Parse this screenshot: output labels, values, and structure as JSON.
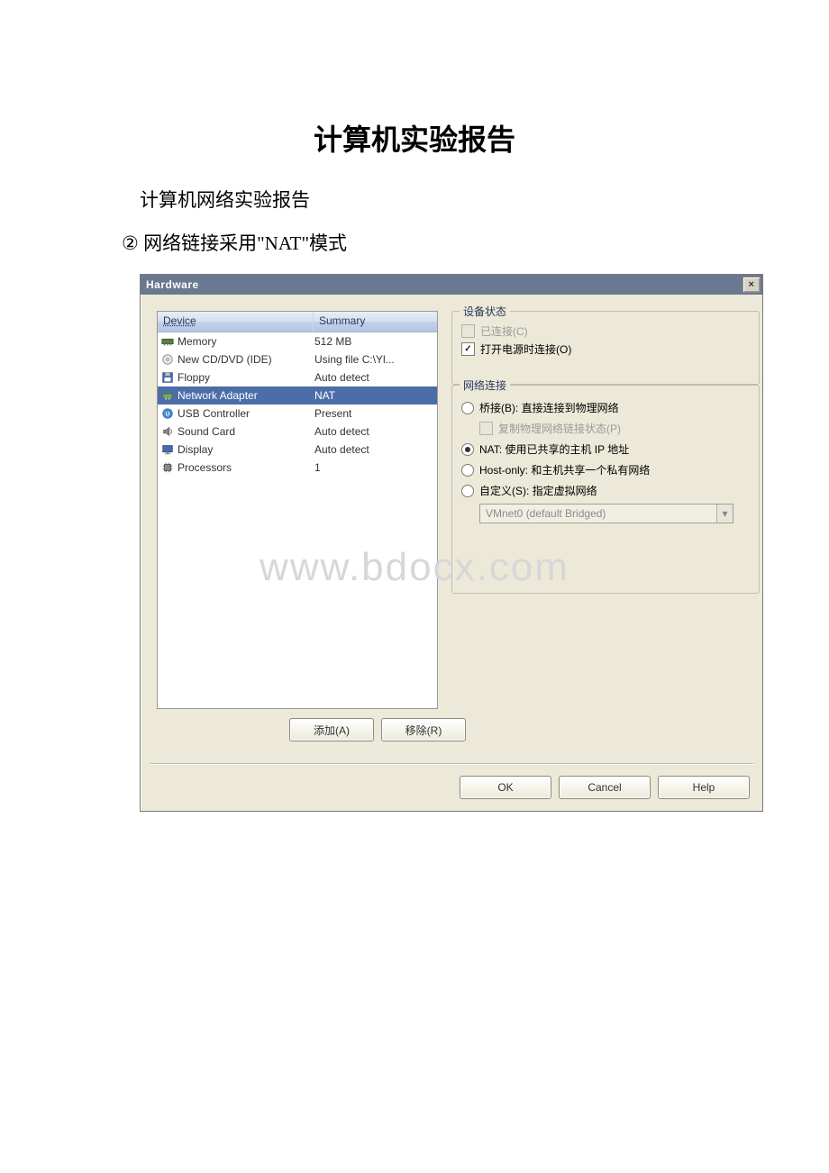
{
  "doc": {
    "title": "计算机实验报告",
    "subtitle": "计算机网络实验报告",
    "line2_prefix": "②",
    "line2_text": "网络链接采用\"NAT\"模式",
    "watermark": "www.bdocx.com"
  },
  "dialog": {
    "title": "Hardware",
    "close": "×",
    "list": {
      "header_device": "Device",
      "header_summary": "Summary",
      "rows": [
        {
          "icon": "memory-icon",
          "name": "Memory",
          "summary": "512 MB",
          "selected": false
        },
        {
          "icon": "cd-icon",
          "name": "New CD/DVD (IDE)",
          "summary": "Using file C:\\Yl...",
          "selected": false
        },
        {
          "icon": "floppy-icon",
          "name": "Floppy",
          "summary": "Auto detect",
          "selected": false
        },
        {
          "icon": "network-icon",
          "name": "Network Adapter",
          "summary": "NAT",
          "selected": true
        },
        {
          "icon": "usb-icon",
          "name": "USB Controller",
          "summary": "Present",
          "selected": false
        },
        {
          "icon": "sound-icon",
          "name": "Sound Card",
          "summary": "Auto detect",
          "selected": false
        },
        {
          "icon": "display-icon",
          "name": "Display",
          "summary": "Auto detect",
          "selected": false
        },
        {
          "icon": "processor-icon",
          "name": "Processors",
          "summary": "1",
          "selected": false
        }
      ]
    },
    "buttons": {
      "add": "添加(A)",
      "remove": "移除(R)",
      "ok": "OK",
      "cancel": "Cancel",
      "help": "Help"
    },
    "status_group": {
      "title": "设备状态",
      "connected": "已连接(C)",
      "connect_on_power": "打开电源时连接(O)"
    },
    "network_group": {
      "title": "网络连接",
      "bridged": "桥接(B): 直接连接到物理网络",
      "replicate": "复制物理网络链接状态(P)",
      "nat": "NAT: 使用已共享的主机 IP 地址",
      "hostonly": "Host-only: 和主机共享一个私有网络",
      "custom": "自定义(S): 指定虚拟网络",
      "combo": "VMnet0 (default Bridged)"
    }
  }
}
